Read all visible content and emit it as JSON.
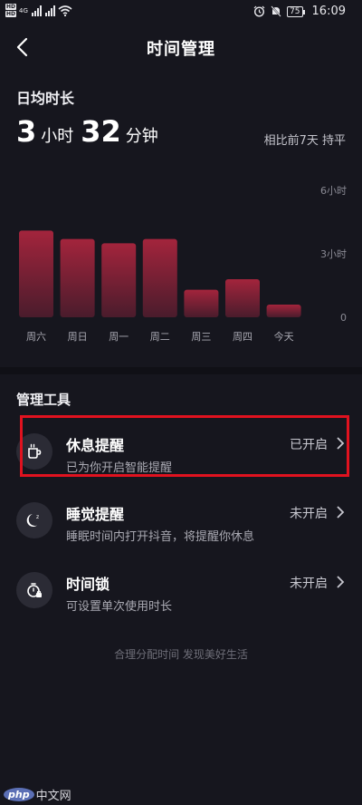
{
  "status_bar": {
    "hd1": "HD",
    "hd2": "HD",
    "network_gen": "4G",
    "battery": "75",
    "time": "16:09"
  },
  "nav": {
    "title": "时间管理"
  },
  "daily_avg": {
    "label": "日均时长",
    "hours": "3",
    "hours_unit": "小时",
    "minutes": "32",
    "minutes_unit": "分钟",
    "compare_text": "相比前7天 持平"
  },
  "chart_data": {
    "type": "bar",
    "categories": [
      "周六",
      "周日",
      "周一",
      "周二",
      "周三",
      "周四",
      "今天"
    ],
    "values": [
      4.1,
      3.7,
      3.5,
      3.7,
      1.3,
      1.8,
      0.6
    ],
    "unit": "小时",
    "ylim": [
      0,
      6
    ],
    "y_tick_labels": [
      "6小时",
      "3小时",
      "0"
    ],
    "bar_color": "#a3243c"
  },
  "tools": {
    "section_label": "管理工具",
    "items": [
      {
        "title": "休息提醒",
        "subtitle": "已为你开启智能提醒",
        "status": "已开启",
        "icon": "cup-icon"
      },
      {
        "title": "睡觉提醒",
        "subtitle": "睡眠时间内打开抖音，将提醒你休息",
        "status": "未开启",
        "icon": "moon-icon"
      },
      {
        "title": "时间锁",
        "subtitle": "可设置单次使用时长",
        "status": "未开启",
        "icon": "timer-lock-icon"
      }
    ]
  },
  "footer": {
    "slogan": "合理分配时间 发现美好生活"
  },
  "watermark": {
    "logo": "php",
    "text": "中文网"
  },
  "colors": {
    "background": "#16161e",
    "bar": "#a3243c",
    "highlight": "#e0121f"
  }
}
